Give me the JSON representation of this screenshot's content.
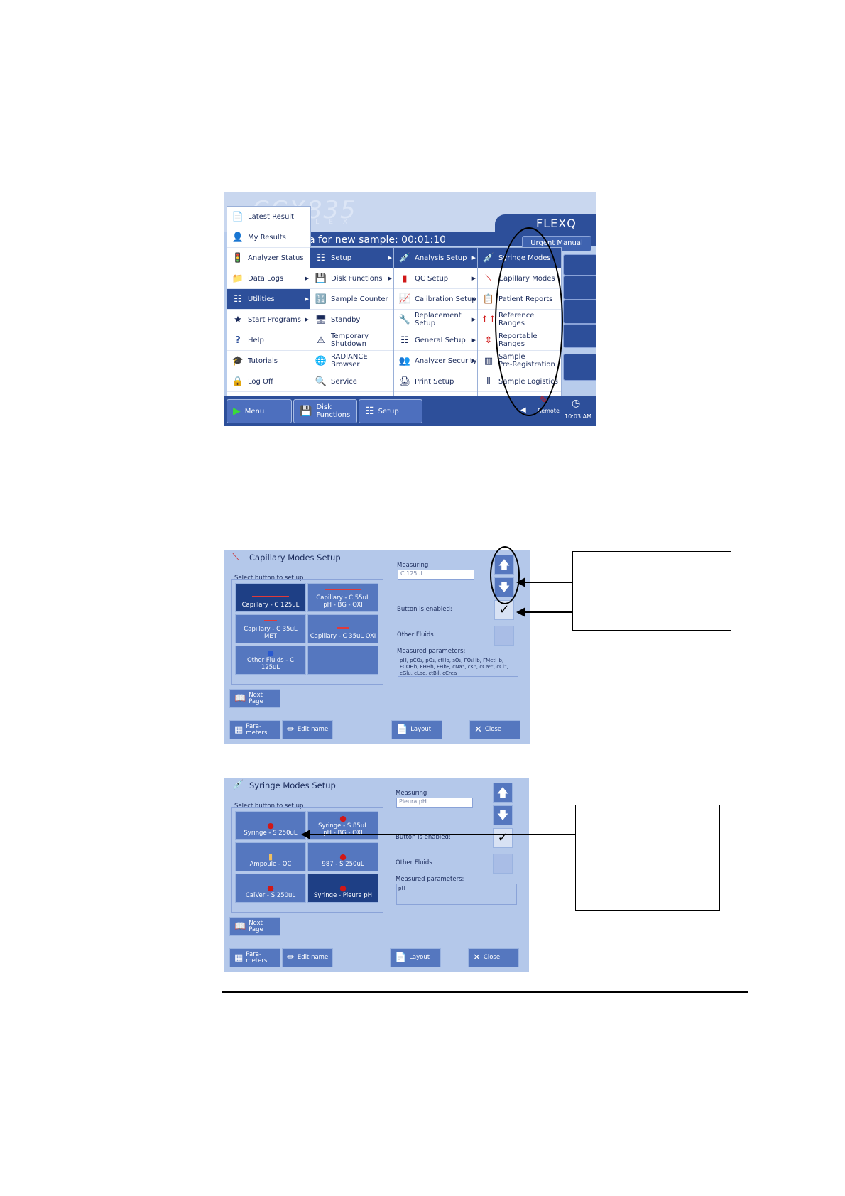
{
  "shot1": {
    "logo": "CCX835",
    "logo_sub": "FLEX",
    "brand": "FLEXQ",
    "status_text": "a for new sample: 00:01:10",
    "urgent_button": "Urgent Manual",
    "main_menu": [
      {
        "label": "Latest Result",
        "icon": "report-icon"
      },
      {
        "label": "My Results",
        "icon": "user-report-icon"
      },
      {
        "label": "Analyzer Status",
        "icon": "traffic-light-icon"
      },
      {
        "label": "Data Logs",
        "icon": "folder-icon"
      },
      {
        "label": "Utilities",
        "icon": "sliders-icon"
      },
      {
        "label": "Start Programs",
        "icon": "programs-icon"
      },
      {
        "label": "Help",
        "icon": "help-icon"
      },
      {
        "label": "Tutorials",
        "icon": "graduation-cap-icon"
      },
      {
        "label": "Log Off",
        "icon": "lock-icon"
      }
    ],
    "utilities_menu": [
      {
        "label": "Setup"
      },
      {
        "label": "Disk Functions"
      },
      {
        "label": "Sample Counter"
      },
      {
        "label": "Standby"
      },
      {
        "label": "Temporary\nShutdown"
      },
      {
        "label": "RADIANCE\nBrowser"
      },
      {
        "label": "Service"
      }
    ],
    "setup_menu": [
      {
        "label": "Analysis Setup"
      },
      {
        "label": "QC Setup"
      },
      {
        "label": "Calibration Setup"
      },
      {
        "label": "Replacement\nSetup"
      },
      {
        "label": "General Setup"
      },
      {
        "label": "Analyzer Security"
      },
      {
        "label": "Print Setup"
      }
    ],
    "analysis_menu": [
      {
        "label": "Syringe Modes"
      },
      {
        "label": "Capillary Modes"
      },
      {
        "label": "Patient Reports"
      },
      {
        "label": "Reference Ranges"
      },
      {
        "label": "Reportable\nRanges"
      },
      {
        "label": "Sample\nPre-Registration"
      },
      {
        "label": "Sample Logistics"
      }
    ],
    "taskbar": {
      "menu": "Menu",
      "disk": "Disk\nFunctions",
      "setup": "Setup",
      "remote": "Remote",
      "time": "10:03 AM"
    }
  },
  "capillary": {
    "title": "Capillary Modes Setup",
    "group_label": "Select button to set up",
    "modes": [
      {
        "label": "Capillary - C 125uL",
        "active": true
      },
      {
        "label": "Capillary - C 55uL\npH - BG - OXI",
        "active": false
      },
      {
        "label": "Capillary - C 35uL\nMET",
        "active": false
      },
      {
        "label": "Capillary - C 35uL OXI",
        "active": false
      },
      {
        "label": "Other Fluids - C\n125uL",
        "active": false
      },
      {
        "label": "",
        "active": false
      }
    ],
    "measuring_label": "Measuring",
    "measuring_value": "C 125uL",
    "enabled_label": "Button is enabled:",
    "other_fluids_label": "Other Fluids",
    "params_label": "Measured parameters:",
    "params_value": "pH, pCO₂, pO₂, ctHb, sO₂, FO₂Hb, FMetHb, FCOHb, FHHb, FHbF, cNa⁺, cK⁺, cCa²⁺, cCl⁻, cGlu, cLac, ctBil, cCrea",
    "next_page": "Next\nPage",
    "parameters": "Para-\nmeters",
    "edit_name": "Edit name",
    "layout": "Layout",
    "close": "Close"
  },
  "syringe": {
    "title": "Syringe Modes Setup",
    "group_label": "Select button to set up",
    "modes": [
      {
        "label": "Syringe - S 250uL",
        "active": false
      },
      {
        "label": "Syringe - S 85uL\npH - BG - OXI",
        "active": false
      },
      {
        "label": "Ampoule - QC",
        "active": false
      },
      {
        "label": "987 - S 250uL",
        "active": false
      },
      {
        "label": "CalVer - S 250uL",
        "active": false
      },
      {
        "label": "Syringe - Pleura pH",
        "active": true
      }
    ],
    "measuring_label": "Measuring",
    "measuring_value": "Pleura pH",
    "enabled_label": "Button is enabled:",
    "other_fluids_label": "Other Fluids",
    "params_label": "Measured parameters:",
    "params_value": "pH",
    "next_page": "Next\nPage",
    "parameters": "Para-\nmeters",
    "edit_name": "Edit name",
    "layout": "Layout",
    "close": "Close"
  }
}
